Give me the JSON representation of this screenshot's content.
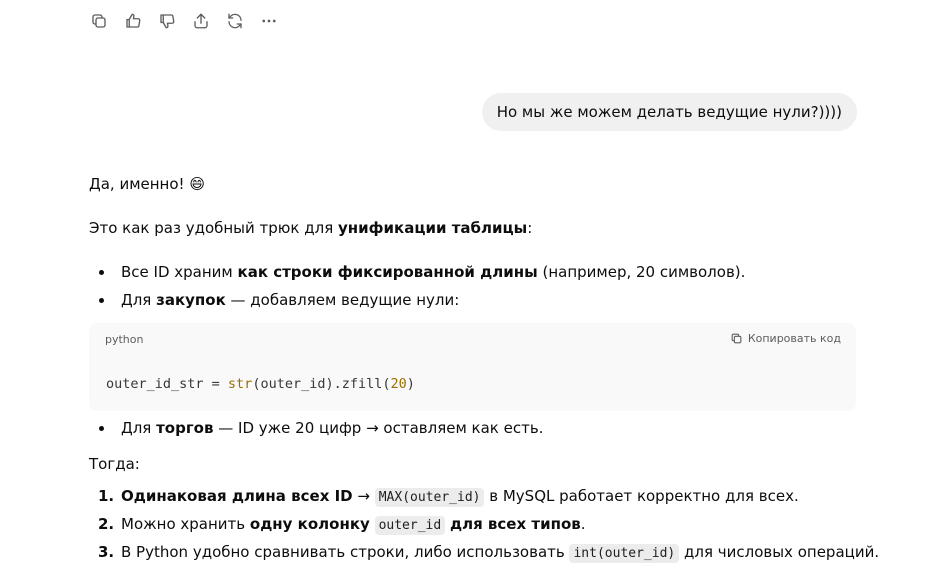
{
  "toolbar": {
    "buttons": [
      {
        "icon": "copy-icon"
      },
      {
        "icon": "thumbs-up-icon"
      },
      {
        "icon": "thumbs-down-icon"
      },
      {
        "icon": "share-icon"
      },
      {
        "icon": "regenerate-icon"
      },
      {
        "icon": "more-icon"
      }
    ]
  },
  "user_message": "Но мы же можем делать ведущие нули?))))",
  "assistant": {
    "greeting": "Да, именно! 😄",
    "intro_text": "Это как раз удобный трюк для ",
    "intro_bold": "унификации таблицы",
    "intro_end": ":",
    "bullets": [
      {
        "pre": "Все ID храним ",
        "bold": "как строки фиксированной длины",
        "post": " (например, 20 символов)."
      },
      {
        "pre": "Для ",
        "bold": "закупок",
        "post": " — добавляем ведущие нули:"
      },
      {
        "pre": "Для ",
        "bold": "торгов",
        "post": " — ID уже 20 цифр → оставляем как есть."
      }
    ],
    "code_block": {
      "language": "python",
      "copy_label": "Копировать код",
      "code": {
        "var": "outer_id_str = ",
        "fn": "str",
        "args": "(outer_id).zfill(",
        "num": "20",
        "close": ")"
      }
    },
    "then_label": "Тогда:",
    "numbered": [
      {
        "num": "1.",
        "bold": "Одинаковая длина всех ID",
        "mid": " → ",
        "code": "MAX(outer_id)",
        "post": " в MySQL работает корректно для всех."
      },
      {
        "num": "2.",
        "pre": "Можно хранить ",
        "bold": "одну колонку",
        "code": "outer_id",
        "bold2": "для всех типов",
        "post": "."
      },
      {
        "num": "3.",
        "pre": "В Python удобно сравнивать строки, либо использовать ",
        "code": "int(outer_id)",
        "post": " для числовых операций."
      }
    ]
  }
}
